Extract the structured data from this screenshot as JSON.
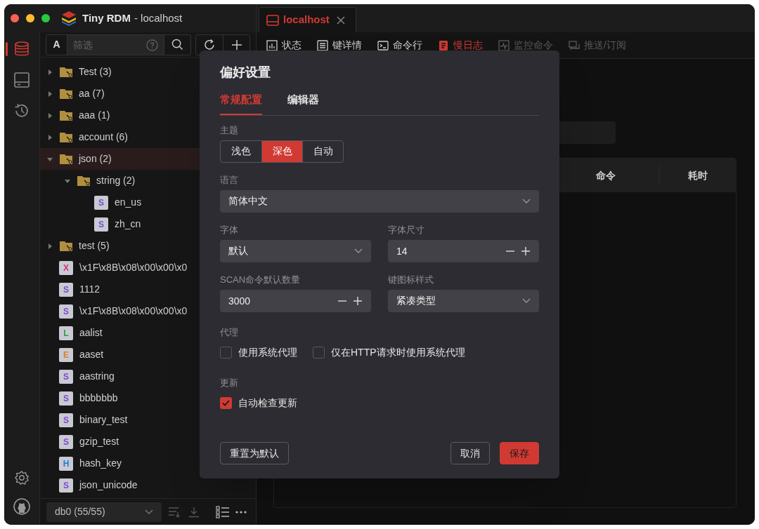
{
  "window": {
    "title": "Tiny RDM",
    "subtitle": "- localhost"
  },
  "nav": [
    {
      "kind": "database",
      "selected": true
    },
    {
      "kind": "terminal",
      "selected": false
    },
    {
      "kind": "history",
      "selected": false
    }
  ],
  "sidebar": {
    "filter": {
      "mode": "A",
      "placeholder": "筛选"
    },
    "tree": [
      {
        "kind": "folder",
        "label": "Test (3)",
        "expanded": false,
        "selected": false
      },
      {
        "kind": "folder",
        "label": "aa (7)",
        "expanded": false,
        "selected": false
      },
      {
        "kind": "folder",
        "label": "aaa (1)",
        "expanded": false,
        "selected": false
      },
      {
        "kind": "folder",
        "label": "account (6)",
        "expanded": false,
        "selected": false
      },
      {
        "kind": "folder",
        "label": "json (2)",
        "expanded": true,
        "selected": true,
        "children": [
          {
            "kind": "folder",
            "label": "string (2)",
            "expanded": true,
            "selected": false,
            "children": [
              {
                "kind": "key",
                "type": "S",
                "color": "#7c4dcc",
                "label": "en_us",
                "selected": false
              },
              {
                "kind": "key",
                "type": "S",
                "color": "#7c4dcc",
                "label": "zh_cn",
                "selected": false
              }
            ]
          }
        ]
      },
      {
        "kind": "folder",
        "label": "test (5)",
        "expanded": false,
        "selected": false
      },
      {
        "kind": "key",
        "type": "X",
        "color": "#d6336c",
        "label": "\\x1F\\x8B\\x08\\x00\\x00\\x0",
        "selected": false
      },
      {
        "kind": "key",
        "type": "S",
        "color": "#7c4dcc",
        "label": "1112",
        "selected": false
      },
      {
        "kind": "key",
        "type": "S",
        "color": "#7c4dcc",
        "label": "\\x1F\\x8B\\x08\\x00\\x00\\x0",
        "selected": false
      },
      {
        "kind": "key",
        "type": "L",
        "color": "#2f9e44",
        "label": "aalist",
        "selected": false
      },
      {
        "kind": "key",
        "type": "E",
        "color": "#d9822b",
        "label": "aaset",
        "selected": false
      },
      {
        "kind": "key",
        "type": "S",
        "color": "#7c4dcc",
        "label": "aastring",
        "selected": false
      },
      {
        "kind": "key",
        "type": "S",
        "color": "#7c4dcc",
        "label": "bbbbbbb",
        "selected": false
      },
      {
        "kind": "key",
        "type": "S",
        "color": "#7c4dcc",
        "label": "binary_test",
        "selected": false
      },
      {
        "kind": "key",
        "type": "S",
        "color": "#7c4dcc",
        "label": "gzip_test",
        "selected": false
      },
      {
        "kind": "key",
        "type": "H",
        "color": "#1c7ed6",
        "label": "hash_key",
        "selected": false
      },
      {
        "kind": "key",
        "type": "S",
        "color": "#7c4dcc",
        "label": "json_unicode",
        "selected": false
      }
    ],
    "db_select": "db0 (55/55)"
  },
  "main": {
    "connection_tab": {
      "label": "localhost"
    },
    "subtabs": [
      {
        "kind": "status",
        "label": "状态",
        "selected": false,
        "disabled": false
      },
      {
        "kind": "detail",
        "label": "键详情",
        "selected": false,
        "disabled": false
      },
      {
        "kind": "cli",
        "label": "命令行",
        "selected": false,
        "disabled": false
      },
      {
        "kind": "slowlog",
        "label": "慢日志",
        "selected": true,
        "disabled": false
      },
      {
        "kind": "monitor",
        "label": "监控命令",
        "selected": false,
        "disabled": true
      },
      {
        "kind": "pubsub",
        "label": "推送/订阅",
        "selected": false,
        "disabled": true
      }
    ],
    "table": {
      "columns": [
        "命令",
        "耗时"
      ]
    }
  },
  "dialog": {
    "title": "偏好设置",
    "tabs": [
      {
        "label": "常规配置",
        "selected": true
      },
      {
        "label": "编辑器",
        "selected": false
      }
    ],
    "theme": {
      "label": "主题",
      "options": [
        {
          "label": "浅色",
          "selected": false
        },
        {
          "label": "深色",
          "selected": true
        },
        {
          "label": "自动",
          "selected": false
        }
      ]
    },
    "language": {
      "label": "语言",
      "value": "简体中文"
    },
    "font": {
      "label": "字体",
      "value": "默认"
    },
    "font_size": {
      "label": "字体尺寸",
      "value": "14"
    },
    "scan_size": {
      "label": "SCAN命令默认数量",
      "value": "3000"
    },
    "key_icon_style": {
      "label": "键图标样式",
      "value": "紧凑类型"
    },
    "proxy": {
      "label": "代理",
      "options": [
        {
          "label": "使用系统代理",
          "checked": false
        },
        {
          "label": "仅在HTTP请求时使用系统代理",
          "checked": false
        }
      ]
    },
    "update": {
      "label": "更新",
      "options": [
        {
          "label": "自动检查更新",
          "checked": true
        }
      ]
    },
    "buttons": [
      {
        "label": "重置为默认",
        "kind": "secondary"
      },
      {
        "label": "取消",
        "kind": "secondary"
      },
      {
        "label": "保存",
        "kind": "primary"
      }
    ]
  }
}
